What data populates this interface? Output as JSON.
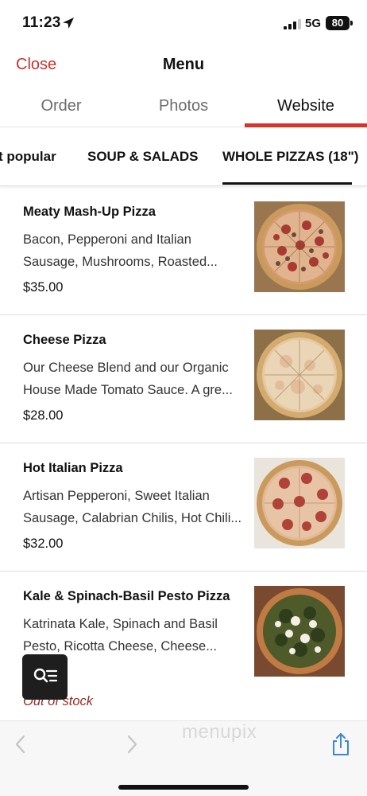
{
  "status_bar": {
    "time": "11:23",
    "network": "5G",
    "battery": "80"
  },
  "header": {
    "close_label": "Close",
    "title": "Menu"
  },
  "top_tabs": [
    {
      "label": "Order",
      "active": false
    },
    {
      "label": "Photos",
      "active": false
    },
    {
      "label": "Website",
      "active": true
    }
  ],
  "category_tabs": [
    {
      "label": "t popular",
      "active": false
    },
    {
      "label": "SOUP & SALADS",
      "active": false
    },
    {
      "label": "WHOLE PIZZAS (18\")",
      "active": true
    }
  ],
  "menu_items": [
    {
      "name": "Meaty Mash-Up Pizza",
      "description_line1": "Bacon, Pepperoni and Italian",
      "description_line2": "Sausage, Mushrooms, Roasted...",
      "price": "$35.00",
      "image": "meaty-pizza-image"
    },
    {
      "name": "Cheese Pizza",
      "description_line1": "Our Cheese Blend and our Organic",
      "description_line2": "House Made Tomato Sauce. A gre...",
      "price": "$28.00",
      "image": "cheese-pizza-image"
    },
    {
      "name": "Hot Italian Pizza",
      "description_line1": "Artisan Pepperoni, Sweet Italian",
      "description_line2": "Sausage, Calabrian Chilis, Hot Chili...",
      "price": "$32.00",
      "image": "hot-italian-pizza-image"
    },
    {
      "name": "Kale & Spinach-Basil Pesto Pizza",
      "description_line1": "Katrinata Kale, Spinach and Basil",
      "description_line2": "Pesto, Ricotta Cheese, Cheese...",
      "status": "Out of stock",
      "image": "pesto-pizza-image"
    }
  ],
  "watermark": "menupix",
  "icons": {
    "location": "location-arrow-icon",
    "signal": "signal-bars-icon",
    "menu_search": "search-list-icon",
    "back": "chevron-left-icon",
    "forward": "chevron-right-icon",
    "share": "share-icon"
  },
  "colors": {
    "accent": "#d8322b",
    "close_text": "#c8312b",
    "out_of_stock": "#9b2a26"
  }
}
